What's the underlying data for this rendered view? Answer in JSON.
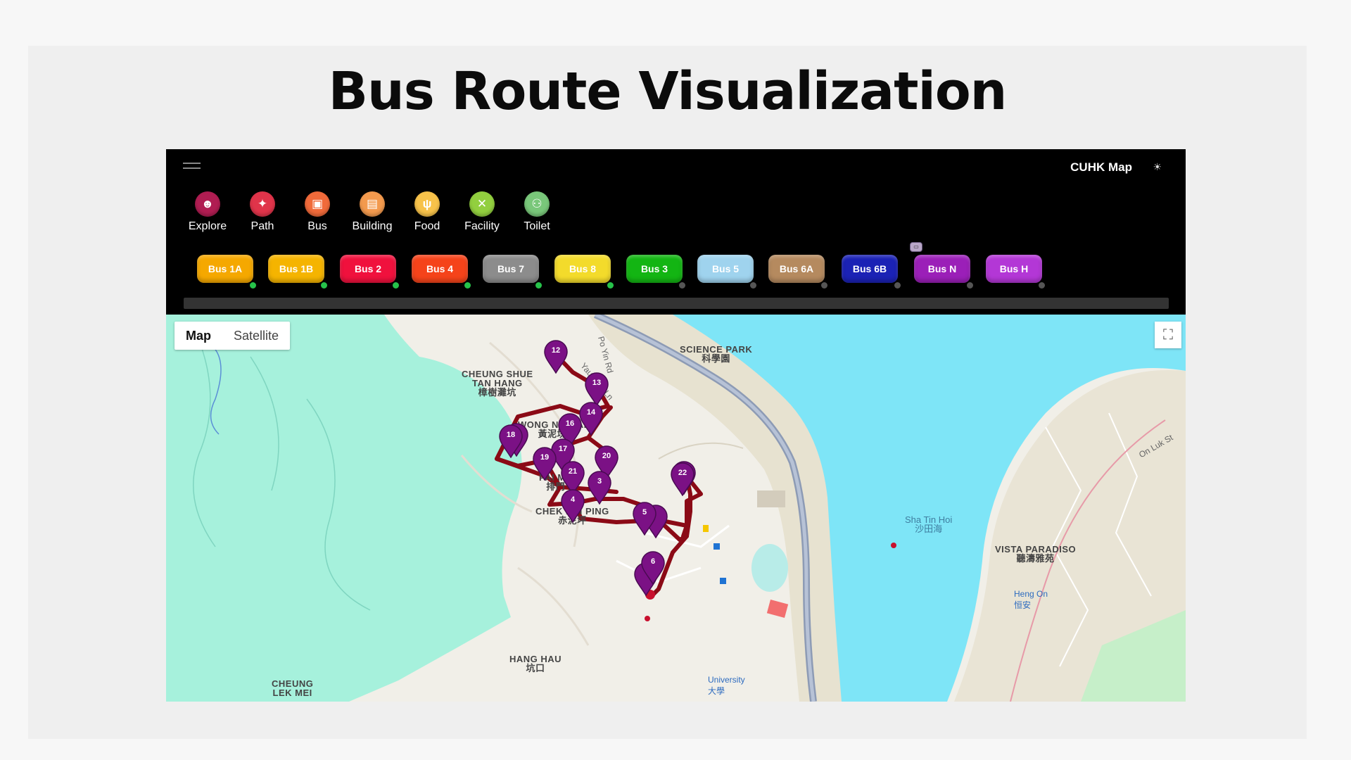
{
  "slide": {
    "title": "Bus Route Visualization"
  },
  "app": {
    "title": "CUHK Map",
    "menu_icon": "hamburger-icon",
    "theme_icon": "sun-icon"
  },
  "categories": [
    {
      "label": "Explore",
      "icon": "compass-icon",
      "glyph": "☻",
      "color": "#b01d52"
    },
    {
      "label": "Path",
      "icon": "walk-icon",
      "glyph": "✦",
      "color": "#e0344a"
    },
    {
      "label": "Bus",
      "icon": "bus-icon",
      "glyph": "▣",
      "color": "#f06a3a"
    },
    {
      "label": "Building",
      "icon": "building-icon",
      "glyph": "▤",
      "color": "#f39a4e"
    },
    {
      "label": "Food",
      "icon": "food-icon",
      "glyph": "ψ",
      "color": "#f7c24a"
    },
    {
      "label": "Facility",
      "icon": "tools-icon",
      "glyph": "✕",
      "color": "#92cf3f"
    },
    {
      "label": "Toilet",
      "icon": "toilet-icon",
      "glyph": "⚇",
      "color": "#79c77a"
    }
  ],
  "buses": [
    {
      "label": "Bus 1A",
      "color": "#f5a800",
      "active": true
    },
    {
      "label": "Bus 1B",
      "color": "#f5b400",
      "active": true
    },
    {
      "label": "Bus 2",
      "color": "#f0113d",
      "active": true
    },
    {
      "label": "Bus 4",
      "color": "#f5431a",
      "active": true
    },
    {
      "label": "Bus 7",
      "color": "#8c8c8c",
      "active": true
    },
    {
      "label": "Bus 8",
      "color": "#f3db2b",
      "active": true
    },
    {
      "label": "Bus 3",
      "color": "#13b513",
      "active": false
    },
    {
      "label": "Bus 5",
      "color": "#9fd3ee",
      "active": false
    },
    {
      "label": "Bus 6A",
      "color": "#b58a5f",
      "active": false
    },
    {
      "label": "Bus 6B",
      "color": "#1b22b5",
      "active": false
    },
    {
      "label": "Bus N",
      "color": "#9b1fb8",
      "active": false,
      "badge": true
    },
    {
      "label": "Bus H",
      "color": "#b337d6",
      "active": false
    }
  ],
  "status_colors": {
    "active": "#26c24a",
    "inactive": "#555555"
  },
  "map": {
    "toggle": {
      "map_label": "Map",
      "satellite_label": "Satellite"
    },
    "places": [
      {
        "text": "SCIENCE PARK\n科學園"
      },
      {
        "text": "CHEUNG SHUE\nTAN HANG\n樟樹灘坑"
      },
      {
        "text": "WONG NAI FAI\n黃泥塊"
      },
      {
        "text": "PAI MU\n排門"
      },
      {
        "text": "CHEK NAI PING\n赤泥坪"
      },
      {
        "text": "HANG HAU\n坑口"
      },
      {
        "text": "CHEUNG\nLEK MEI"
      },
      {
        "text": "VISTA PARADISO\n聽濤雅苑"
      }
    ],
    "water_label": "Sha Tin Hoi\n沙田海",
    "stations": [
      {
        "text": "University\n大學"
      },
      {
        "text": "Heng On\n恒安"
      }
    ],
    "roads": [
      {
        "text": "Yau King Ln"
      },
      {
        "text": "Po Yin Rd"
      },
      {
        "text": "On Luk St"
      }
    ],
    "route_color": "#8b0a16",
    "pin_color": "#7b1185",
    "stops": [
      "12",
      "13",
      "14",
      "16",
      "18",
      "17",
      "19",
      "20",
      "21",
      "3",
      "22",
      "4",
      "5",
      "6"
    ]
  }
}
